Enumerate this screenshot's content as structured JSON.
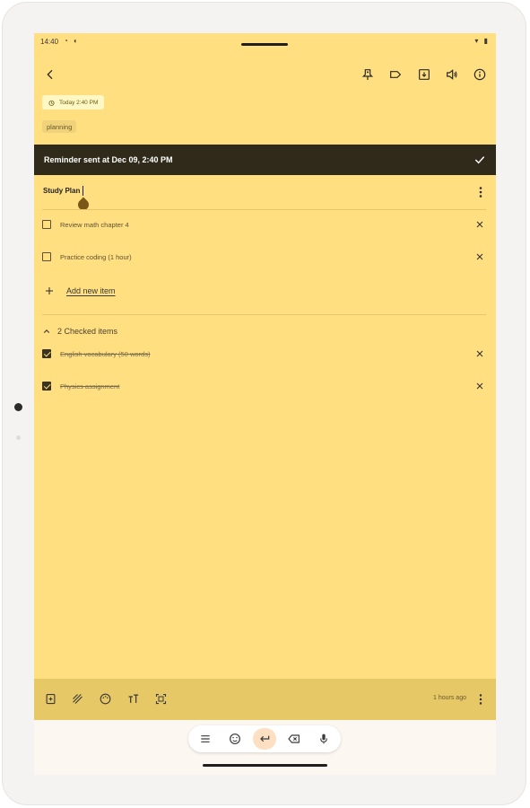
{
  "status_bar": {
    "time": "14:40"
  },
  "note": {
    "reminder_chip": "Today 2:40 PM",
    "label_chip": "planning",
    "title": "Study Plan",
    "unchecked_items": [
      {
        "text": "Review math chapter 4"
      },
      {
        "text": "Practice coding (1 hour)"
      }
    ],
    "add_item_label": "Add new item",
    "checked_header": "2 Checked items",
    "checked_items": [
      {
        "text": "English vocabulary (50 words)"
      },
      {
        "text": "Physics assignment"
      }
    ]
  },
  "snackbar": {
    "message": "Reminder sent at Dec 09, 2:40 PM"
  },
  "bottom_toolbar": {
    "edited": "1 hours ago"
  },
  "colors": {
    "note_background": "#ffdf80",
    "toolbar_background": "#e6c867",
    "snackbar_background": "#2f2a1a"
  },
  "icons": {
    "appbar": [
      "back-arrow-icon",
      "pin-icon",
      "label-icon",
      "archive-icon",
      "speaker-icon",
      "info-icon"
    ],
    "bottom_toolbar": [
      "new-note-icon",
      "draw-icon",
      "palette-icon",
      "text-format-icon",
      "scan-icon",
      "more-vert-icon"
    ],
    "keyboard_bar": [
      "menu-icon",
      "emoji-icon",
      "enter-icon",
      "backspace-icon",
      "mic-icon"
    ]
  }
}
